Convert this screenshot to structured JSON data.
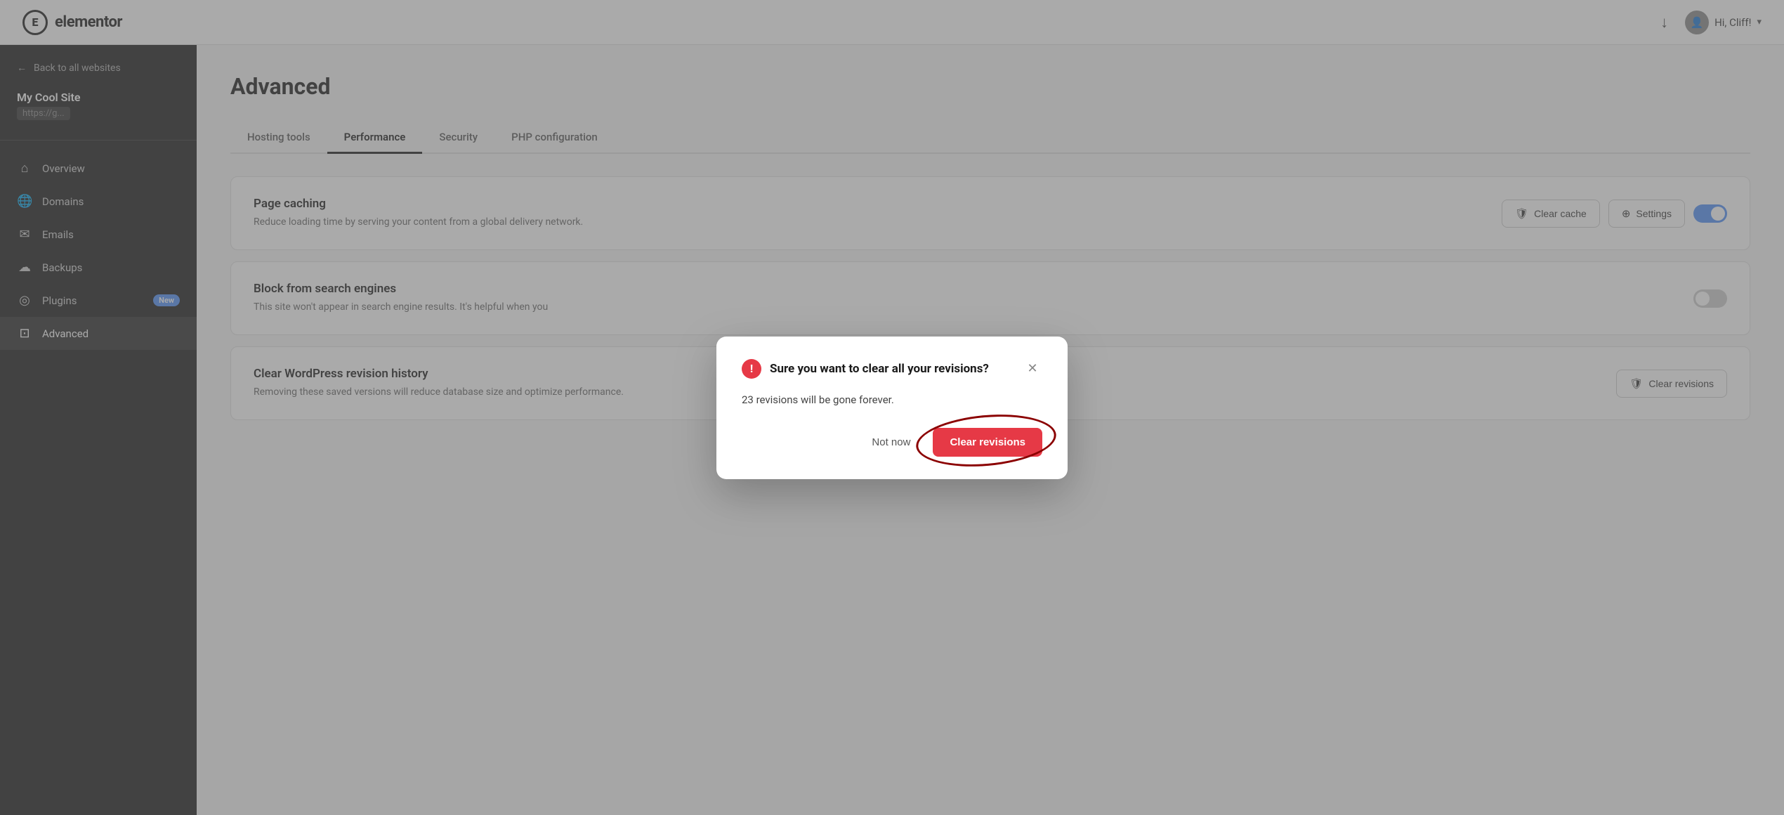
{
  "topbar": {
    "logo_letter": "E",
    "logo_name": "elementor",
    "user_greeting": "Hi, Cliff!",
    "download_icon": "↓",
    "chevron": "▾"
  },
  "sidebar": {
    "back_label": "Back to all websites",
    "site_name": "My Cool Site",
    "site_url": "https://g...",
    "nav_items": [
      {
        "id": "overview",
        "label": "Overview",
        "icon": "⌂"
      },
      {
        "id": "domains",
        "label": "Domains",
        "icon": "🌐"
      },
      {
        "id": "emails",
        "label": "Emails",
        "icon": "✉"
      },
      {
        "id": "backups",
        "label": "Backups",
        "icon": "☁"
      },
      {
        "id": "plugins",
        "label": "Plugins",
        "icon": "◎",
        "badge": "New"
      },
      {
        "id": "advanced",
        "label": "Advanced",
        "icon": "⊡",
        "active": true
      }
    ]
  },
  "main": {
    "page_title": "Advanced",
    "tabs": [
      {
        "id": "hosting",
        "label": "Hosting tools"
      },
      {
        "id": "performance",
        "label": "Performance",
        "active": true
      },
      {
        "id": "security",
        "label": "Security"
      },
      {
        "id": "php",
        "label": "PHP configuration"
      }
    ],
    "cards": [
      {
        "id": "page-caching",
        "title": "Page caching",
        "desc": "Reduce loading time by serving your content from a global delivery network.",
        "actions": [
          "clear_cache",
          "settings"
        ],
        "toggle": true,
        "toggle_on": true
      },
      {
        "id": "block-search",
        "title": "Block from search engines",
        "desc": "This site won't appear in search engine results.\nIt's helpful when you",
        "toggle": true,
        "toggle_on": false
      },
      {
        "id": "clear-revisions",
        "title": "Clear WordPress revision history",
        "desc": "Removing these saved versions will reduce database size and optimize performance.",
        "actions": [
          "clear_revisions_btn"
        ]
      }
    ],
    "btn_clear_cache": "Clear cache",
    "btn_settings": "Settings",
    "btn_clear_revisions": "Clear revisions"
  },
  "modal": {
    "title": "Sure you want to clear all your revisions?",
    "body": "23 revisions will be gone forever.",
    "cancel_label": "Not now",
    "confirm_label": "Clear revisions",
    "close_icon": "✕",
    "warning_icon": "!"
  }
}
